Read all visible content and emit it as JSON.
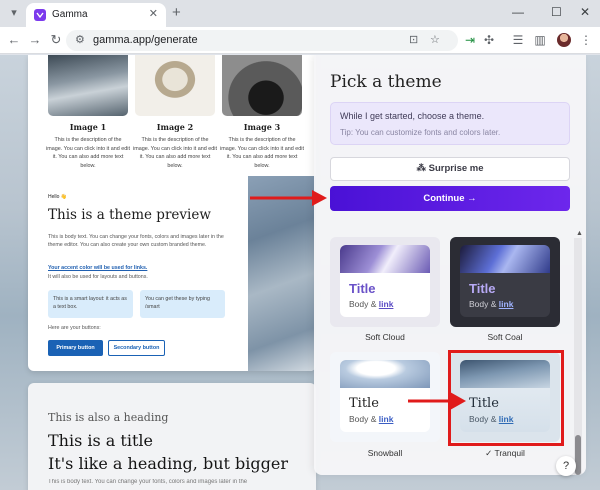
{
  "browser": {
    "tab_title": "Gamma",
    "tab_close": "✕",
    "new_tab": "+",
    "window_controls": {
      "minimize": "—",
      "maximize": "☐",
      "close": "✕"
    },
    "nav": {
      "back": "←",
      "forward": "→",
      "reload": "↻"
    },
    "url": "gamma.app/generate",
    "tune_icon": "⚙",
    "icons": [
      "install-app-icon",
      "bookmark-star-icon",
      "extension-arrow-icon",
      "extensions-puzzle-icon",
      "reading-list-icon",
      "sidebar-icon",
      "profile-avatar",
      "menu-dots-icon"
    ],
    "glyphs": {
      "install": "⊡",
      "star": "☆",
      "ext_arrow": "⇥",
      "puzzle": "✣",
      "reading": "☰",
      "sidebar": "▥",
      "menu": "⋮"
    },
    "colors": {
      "tab_favicon": "#7c3aed"
    }
  },
  "preview": {
    "images": [
      {
        "title": "Image 1",
        "desc": "This is the description of the image. You can click into it and edit it. You can also add more text below."
      },
      {
        "title": "Image 2",
        "desc": "This is the description of the image. You can click into it and edit it. You can also add more text below."
      },
      {
        "title": "Image 3",
        "desc": "This is the description of the image. You can click into it and edit it. You can also add more text below."
      }
    ],
    "hello": "Hello 👋",
    "title": "This is a theme preview",
    "body": "This is body text. You can change your fonts, colors and images later in the theme editor. You can also create your own custom branded theme.",
    "accent_link": "Your accent color will be used for links.",
    "accent_sub": "It will also be used for layouts and buttons.",
    "textbox1": "This is a smart layout: it acts as a text box.",
    "textbox2": "You can get these by typing /smart",
    "buttons_label": "Here are your buttons:",
    "primary_button": "Primary button",
    "secondary_button": "Secondary button",
    "card2": {
      "subheading": "This is also a heading",
      "title": "This is a title",
      "big": "It's like a heading, but bigger",
      "body": "This is body text. You can change your fonts, colors and images later in the"
    }
  },
  "panel": {
    "heading": "Pick a theme",
    "message": "While I get started, choose a theme.",
    "tip": "Tip: You can customize fonts and colors later.",
    "surprise_label": "Surprise me",
    "continue_label": "Continue →",
    "scroll_up_glyph": "▲",
    "themes": [
      {
        "name": "Soft Cloud",
        "title": "Title",
        "body_text": "Body & ",
        "link_text": "link",
        "selected": false
      },
      {
        "name": "Soft Coal",
        "title": "Title",
        "body_text": "Body & ",
        "link_text": "link",
        "selected": false
      },
      {
        "name": "Snowball",
        "title": "Title",
        "body_text": "Body & ",
        "link_text": "link",
        "selected": false
      },
      {
        "name": "✓ Tranquil",
        "title": "Title",
        "body_text": "Body & ",
        "link_text": "link",
        "selected": true
      }
    ],
    "help": "?",
    "colors": {
      "continue": "#5b1be3",
      "highlight": "#e01b1b",
      "arrow": "#e01b1b"
    }
  }
}
